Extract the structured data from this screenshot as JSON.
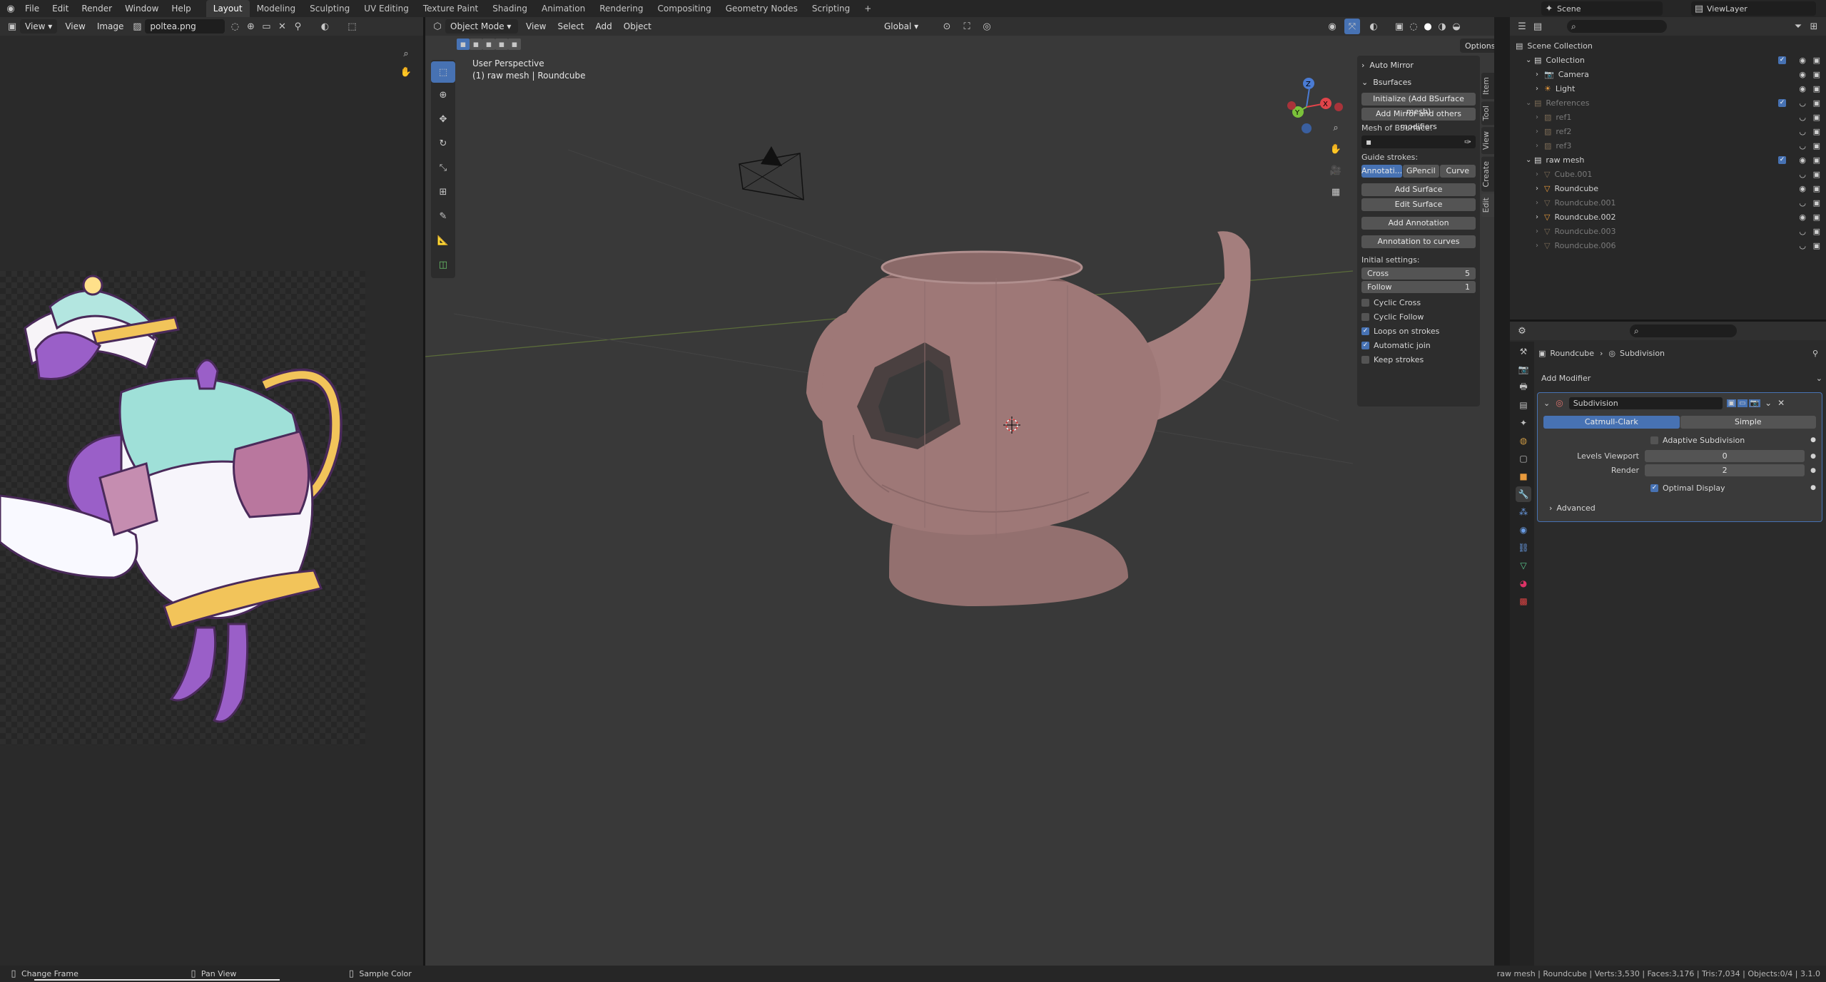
{
  "topbar": {
    "menus": [
      "File",
      "Edit",
      "Render",
      "Window",
      "Help"
    ],
    "workspaces": [
      "Layout",
      "Modeling",
      "Sculpting",
      "UV Editing",
      "Texture Paint",
      "Shading",
      "Animation",
      "Rendering",
      "Compositing",
      "Geometry Nodes",
      "Scripting"
    ],
    "active_workspace": "Layout",
    "add_tab": "+",
    "scene": "Scene",
    "view_layer": "ViewLayer"
  },
  "image_editor": {
    "view_label": "View",
    "menus": [
      "View",
      "Image"
    ],
    "image_name": "poltea.png"
  },
  "viewport": {
    "mode": "Object Mode",
    "menus": [
      "View",
      "Select",
      "Add",
      "Object"
    ],
    "orientation": "Global",
    "options_label": "Options",
    "perspective_label": "User Perspective",
    "object_label": "(1) raw mesh | Roundcube"
  },
  "bsurfaces_panel": {
    "auto_mirror": "Auto Mirror",
    "title": "Bsurfaces",
    "initialize_button": "Initialize (Add BSurface mesh)",
    "add_mirror_button": "Add Mirror and others modifiers",
    "mesh_label": "Mesh of BSurface:",
    "guide_label": "Guide strokes:",
    "guide_options": [
      "Annotati...",
      "GPencil",
      "Curve"
    ],
    "active_guide": "Annotati...",
    "add_surface": "Add Surface",
    "edit_surface": "Edit Surface",
    "add_annotation": "Add Annotation",
    "annotation_to_curves": "Annotation to curves",
    "initial_settings": "Initial settings:",
    "cross_label": "Cross",
    "cross_value": "5",
    "follow_label": "Follow",
    "follow_value": "1",
    "checks": [
      {
        "label": "Cyclic Cross",
        "checked": false
      },
      {
        "label": "Cyclic Follow",
        "checked": false
      },
      {
        "label": "Loops on strokes",
        "checked": true
      },
      {
        "label": "Automatic join",
        "checked": true
      },
      {
        "label": "Keep strokes",
        "checked": false
      }
    ],
    "side_tabs": [
      "Item",
      "Tool",
      "View",
      "Create",
      "Edit"
    ]
  },
  "outliner": {
    "root": "Scene Collection",
    "rows": [
      {
        "label": "Collection",
        "indent": 1,
        "dim": false
      },
      {
        "label": "Camera",
        "indent": 2,
        "dim": false
      },
      {
        "label": "Light",
        "indent": 2,
        "dim": false
      },
      {
        "label": "References",
        "indent": 1,
        "dim": true
      },
      {
        "label": "ref1",
        "indent": 2,
        "dim": true
      },
      {
        "label": "ref2",
        "indent": 2,
        "dim": true
      },
      {
        "label": "ref3",
        "indent": 2,
        "dim": true
      },
      {
        "label": "raw mesh",
        "indent": 1,
        "dim": false
      },
      {
        "label": "Cube.001",
        "indent": 2,
        "dim": true
      },
      {
        "label": "Roundcube",
        "indent": 2,
        "dim": false
      },
      {
        "label": "Roundcube.001",
        "indent": 2,
        "dim": true
      },
      {
        "label": "Roundcube.002",
        "indent": 2,
        "dim": false
      },
      {
        "label": "Roundcube.003",
        "indent": 2,
        "dim": true
      },
      {
        "label": "Roundcube.006",
        "indent": 2,
        "dim": true
      }
    ]
  },
  "properties": {
    "breadcrumb_object": "Roundcube",
    "breadcrumb_modifier": "Subdivision",
    "add_modifier": "Add Modifier",
    "modifier_name": "Subdivision",
    "catmull_clark": "Catmull-Clark",
    "simple": "Simple",
    "adaptive": "Adaptive Subdivision",
    "levels_viewport_label": "Levels Viewport",
    "levels_viewport_value": "0",
    "render_label": "Render",
    "render_value": "2",
    "optimal_display": "Optimal Display",
    "advanced": "Advanced"
  },
  "statusbar": {
    "change_frame": "Change Frame",
    "pan_view": "Pan View",
    "sample_color": "Sample Color",
    "stats": "raw mesh | Roundcube | Verts:3,530 | Faces:3,176 | Tris:7,034 | Objects:0/4 | 3.1.0"
  },
  "colors": {
    "accent": "#4772b3",
    "teapot": "#9e7877",
    "background": "#393939"
  }
}
